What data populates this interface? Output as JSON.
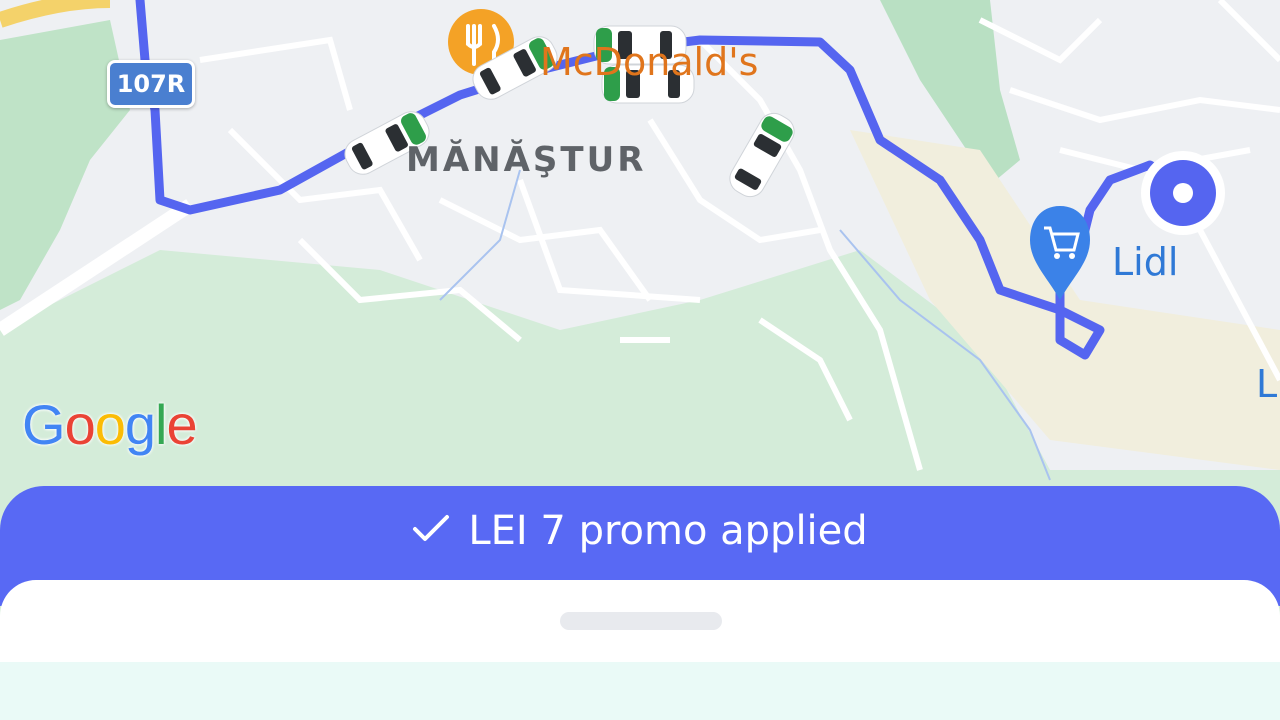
{
  "map": {
    "district_label": "MĂNĂŞTUR",
    "poi_restaurant": "McDonald's",
    "poi_shop": "Lidl",
    "poi_edge": "L",
    "road_shield": "107R",
    "attribution": {
      "g1": "G",
      "o1": "o",
      "o2": "o",
      "g2": "g",
      "l": "l",
      "e": "e"
    },
    "route_color": "#5565f0",
    "icons": [
      "fork-knife-icon",
      "shopping-cart-icon",
      "destination-pin-icon",
      "car-icon"
    ]
  },
  "promo": {
    "label": "LEI 7 promo applied",
    "icon": "check-icon",
    "bar_color": "#5869f4"
  }
}
